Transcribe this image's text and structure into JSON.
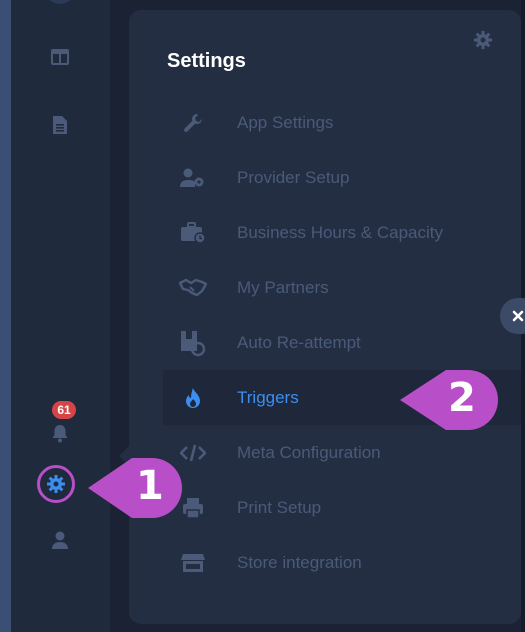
{
  "rail": {
    "notification_count": "61",
    "icons": [
      "dashboard-icon",
      "document-icon",
      "bell-icon",
      "gear-icon",
      "user-icon"
    ]
  },
  "panel": {
    "title": "Settings",
    "items": [
      {
        "label": "App Settings",
        "icon": "wrench-icon"
      },
      {
        "label": "Provider Setup",
        "icon": "user-gear-icon"
      },
      {
        "label": "Business Hours & Capacity",
        "icon": "briefcase-clock-icon"
      },
      {
        "label": "My Partners",
        "icon": "handshake-icon"
      },
      {
        "label": "Auto Re-attempt",
        "icon": "reattempt-icon"
      },
      {
        "label": "Triggers",
        "icon": "flame-icon",
        "active": true
      },
      {
        "label": "Meta Configuration",
        "icon": "code-icon"
      },
      {
        "label": "Print Setup",
        "icon": "printer-icon"
      },
      {
        "label": "Store integration",
        "icon": "store-icon"
      }
    ]
  },
  "callouts": {
    "one": "1",
    "two": "2"
  },
  "colors": {
    "accent": "#3b8ef0",
    "highlight": "#b84fc9",
    "badge": "#d64545"
  }
}
